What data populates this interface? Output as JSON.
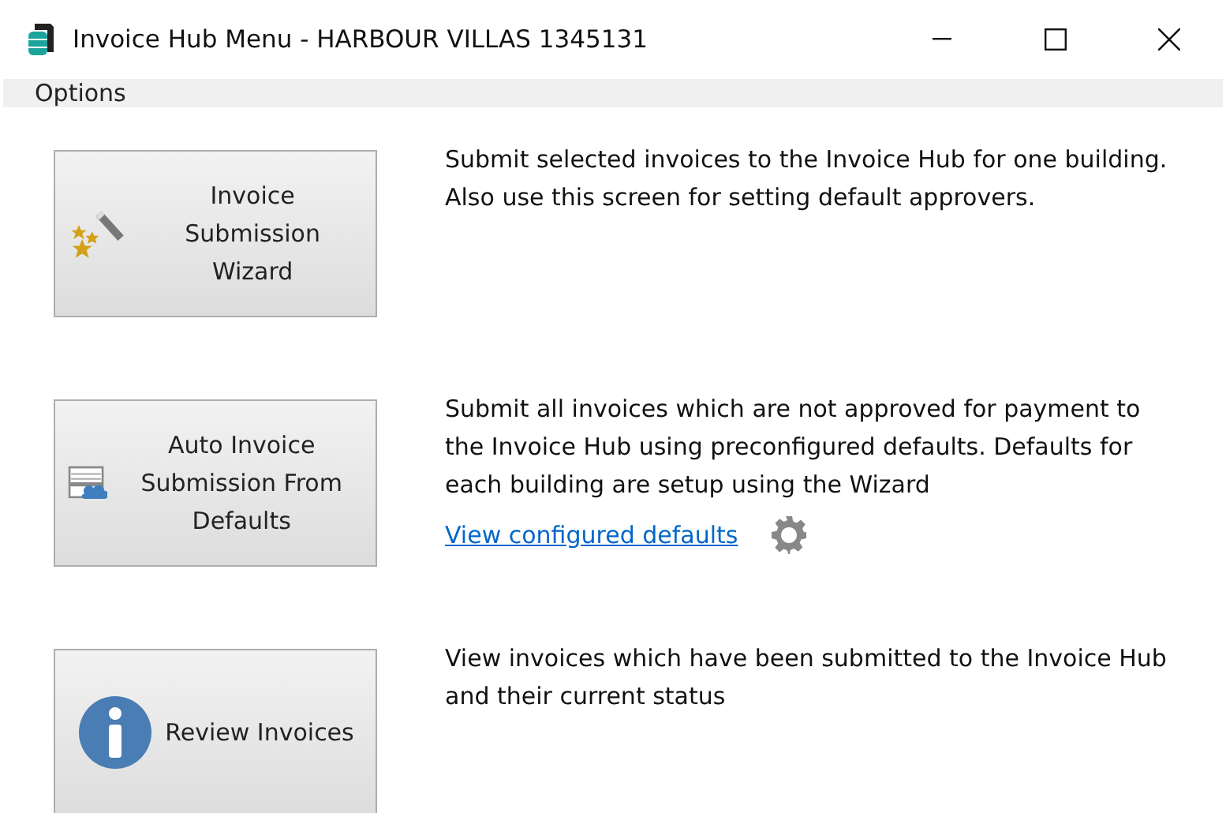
{
  "window": {
    "title": "Invoice Hub Menu - HARBOUR VILLAS 1345131"
  },
  "menu": [
    "Options"
  ],
  "actions": [
    {
      "kind": "wizard",
      "label": "Invoice Submission Wizard",
      "description": "Submit selected invoices to the Invoice Hub for one building. Also use this screen for setting default approvers."
    },
    {
      "kind": "auto",
      "label": "Auto Invoice Submission From Defaults",
      "description": "Submit all invoices which are not approved for payment to the Invoice Hub using preconfigured defaults. Defaults for each building are setup using the Wizard",
      "link": "View configured defaults"
    },
    {
      "kind": "review",
      "label": "Review Invoices",
      "description": "View invoices which have been submitted to the Invoice Hub and their current status"
    }
  ]
}
